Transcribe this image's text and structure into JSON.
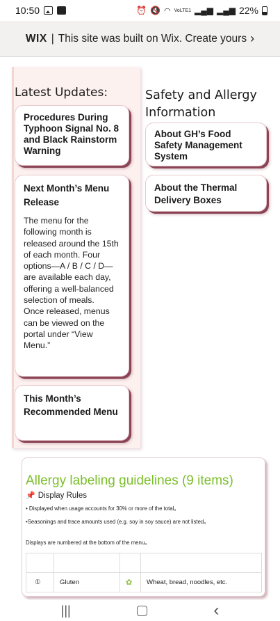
{
  "status_bar": {
    "time": "10:50",
    "network_text": "VoLTE1",
    "battery": "22%",
    "icons": [
      "image-notification-icon",
      "check-notification-icon",
      "alarm-icon",
      "mute-icon",
      "wifi-icon",
      "signal-icon",
      "signal-icon-2",
      "battery-icon"
    ]
  },
  "wix_banner": {
    "logo": "WIX",
    "separator": "|",
    "text": "This site was built on Wix. Create yours",
    "arrow": "›"
  },
  "latest_updates": {
    "title": "Latest Updates:",
    "cards": [
      {
        "title": "Procedures During Typhoon Signal No. 8 and Black Rainstorm Warning"
      },
      {
        "title": "Next Month’s Menu Release",
        "body": "The menu for the following month is released around the 15th of each month. Four options—A / B / C / D—are available each day, offering a well-balanced selection of meals.\nOnce released, menus can be viewed on the portal under “View Menu.”"
      },
      {
        "title": "This Month’s Recommended Menu"
      }
    ]
  },
  "safety": {
    "title_line1": "Safety and Allergy",
    "title_line2": "Information",
    "cards": [
      {
        "title": "About GH’s Food Safety Management System"
      },
      {
        "title": "About the Thermal Delivery Boxes"
      }
    ]
  },
  "allergy": {
    "title": "Allergy labeling guidelines (9 items)",
    "rules_label": "Display Rules",
    "lines": [
      "• Displayed when usage accounts for 30% or more of the total。",
      "•Seasonings and trace amounts used (e.g. soy in soy sauce) are not listed。",
      "Displays are numbered at the bottom of the menu。"
    ],
    "table_row": {
      "number": "①",
      "name": "Gluten",
      "foods": "Wheat, bread, noodles, etc."
    }
  },
  "nav": {
    "recent": "|||",
    "back": "‹"
  },
  "colors": {
    "accent_green": "#7bbf2a",
    "card_shadow": "#8a4455",
    "panel_pink": "#fdf1f0"
  }
}
